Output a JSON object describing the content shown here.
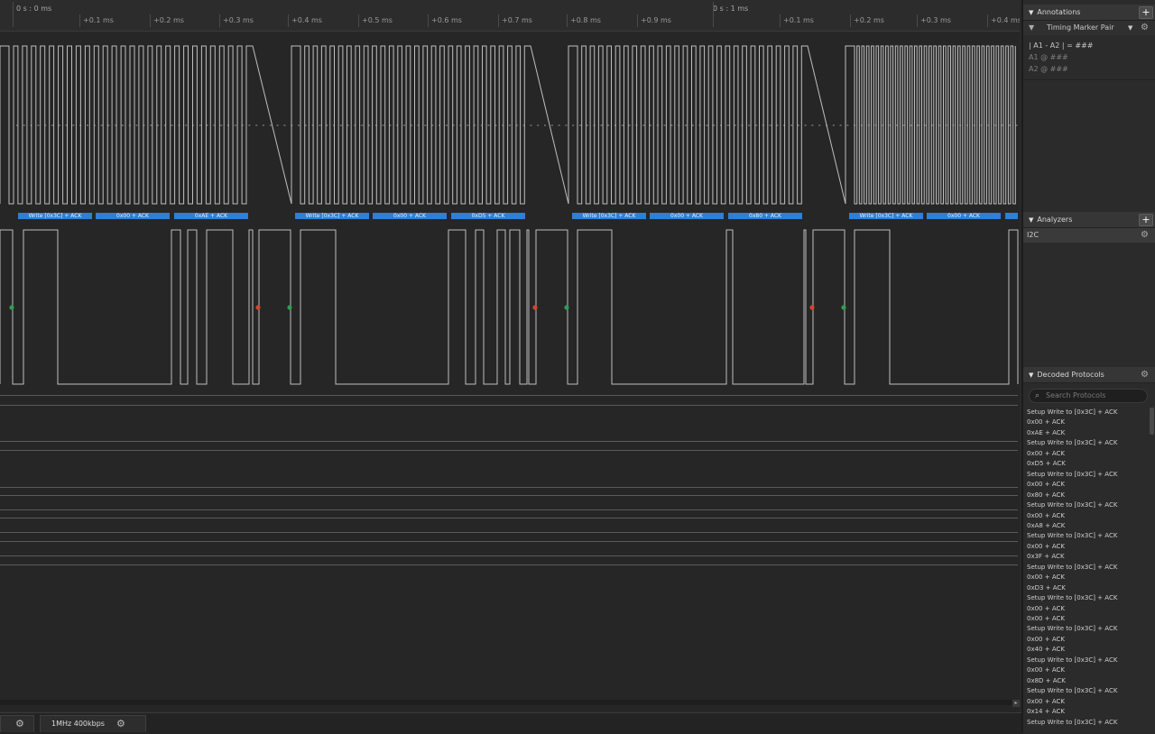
{
  "ruler": {
    "start_label": "0 s : 0 ms",
    "second_label": "0 s : 1 ms",
    "ticks": [
      "+0.1 ms",
      "+0.2 ms",
      "+0.3 ms",
      "+0.4 ms",
      "+0.5 ms",
      "+0.6 ms",
      "+0.7 ms",
      "+0.8 ms",
      "+0.9 ms",
      "+0.1 ms",
      "+0.2 ms",
      "+0.3 ms",
      "+0.4 ms"
    ]
  },
  "bubbles": [
    "Write [0x3C] + ACK",
    "0x00 + ACK",
    "0xAE + ACK",
    "Write [0x3C] + ACK",
    "0x00 + ACK",
    "0xD5 + ACK",
    "Write [0x3C] + ACK",
    "0x00 + ACK",
    "0x80 + ACK",
    "Write [0x3C] + ACK",
    "0x00 + ACK"
  ],
  "bottom": {
    "tab_label": "1MHz 400kbps"
  },
  "annotations": {
    "title": "Annotations",
    "marker_pair": "Timing Marker Pair",
    "formula": "| A1 - A2 | = ###",
    "a1": "A1  @  ###",
    "a2": "A2  @  ###"
  },
  "analyzers": {
    "title": "Analyzers",
    "items": [
      "I2C"
    ]
  },
  "decoded": {
    "title": "Decoded Protocols",
    "search_placeholder": "Search Protocols",
    "rows": [
      "Setup Write to [0x3C] + ACK",
      "0x00 + ACK",
      "0xAE + ACK",
      "Setup Write to [0x3C] + ACK",
      "0x00 + ACK",
      "0xD5 + ACK",
      "Setup Write to [0x3C] + ACK",
      "0x00 + ACK",
      "0x80 + ACK",
      "Setup Write to [0x3C] + ACK",
      "0x00 + ACK",
      "0xA8 + ACK",
      "Setup Write to [0x3C] + ACK",
      "0x00 + ACK",
      "0x3F + ACK",
      "Setup Write to [0x3C] + ACK",
      "0x00 + ACK",
      "0xD3 + ACK",
      "Setup Write to [0x3C] + ACK",
      "0x00 + ACK",
      "0x00 + ACK",
      "Setup Write to [0x3C] + ACK",
      "0x00 + ACK",
      "0x40 + ACK",
      "Setup Write to [0x3C] + ACK",
      "0x00 + ACK",
      "0x8D + ACK",
      "Setup Write to [0x3C] + ACK",
      "0x00 + ACK",
      "0x14 + ACK",
      "Setup Write to [0x3C] + ACK"
    ]
  },
  "colors": {
    "accent": "#2e7fd6",
    "start_marker": "#2e9e4f",
    "stop_marker": "#d2452e"
  }
}
